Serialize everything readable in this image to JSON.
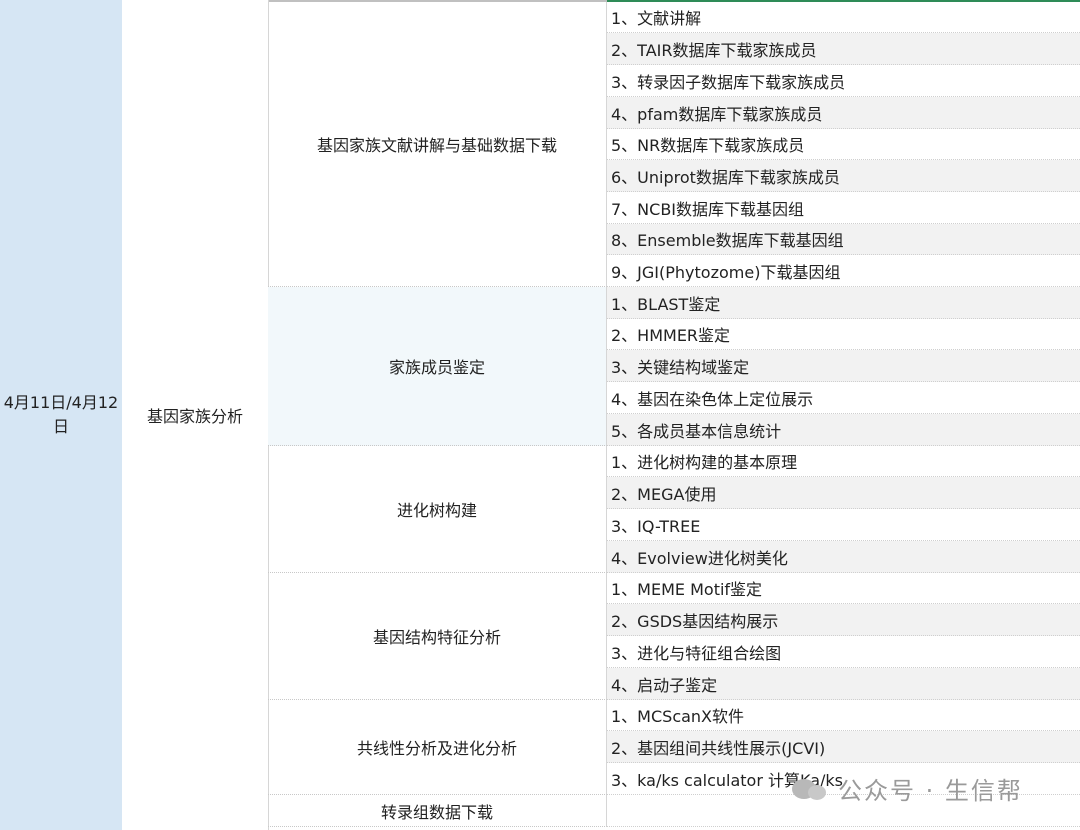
{
  "date": "4月11日/4月12日",
  "course": "基因家族分析",
  "topics": [
    "基因家族文献讲解与基础数据下载",
    "家族成员鉴定",
    "进化树构建",
    "基因结构特征分析",
    "共线性分析及进化分析",
    "转录组数据下载"
  ],
  "items": [
    "1、文献讲解",
    "2、TAIR数据库下载家族成员",
    "3、转录因子数据库下载家族成员",
    "4、pfam数据库下载家族成员",
    "5、NR数据库下载家族成员",
    "6、Uniprot数据库下载家族成员",
    "7、NCBI数据库下载基因组",
    "8、Ensemble数据库下载基因组",
    "9、JGI(Phytozome)下载基因组",
    "1、BLAST鉴定",
    "2、HMMER鉴定",
    "3、关键结构域鉴定",
    "4、基因在染色体上定位展示",
    "5、各成员基本信息统计",
    "1、进化树构建的基本原理",
    "2、MEGA使用",
    "3、IQ-TREE",
    "4、Evolview进化树美化",
    "1、MEME Motif鉴定",
    "2、GSDS基因结构展示",
    "3、进化与特征组合绘图",
    "4、启动子鉴定",
    "1、MCScanX软件",
    "2、基因组间共线性展示(JCVI)",
    "3、ka/ks calculator 计算Ka/ks",
    ""
  ],
  "watermark": {
    "icon": "wechat-official-account-icon",
    "text": "公众号 · 生信帮"
  },
  "colors": {
    "date_cell_bg": "#d6e6f4",
    "alt_row_bg": "#f2f2f2",
    "alt_topic_bg": "#f2f8fb",
    "header_accent": "#2e8b57"
  }
}
